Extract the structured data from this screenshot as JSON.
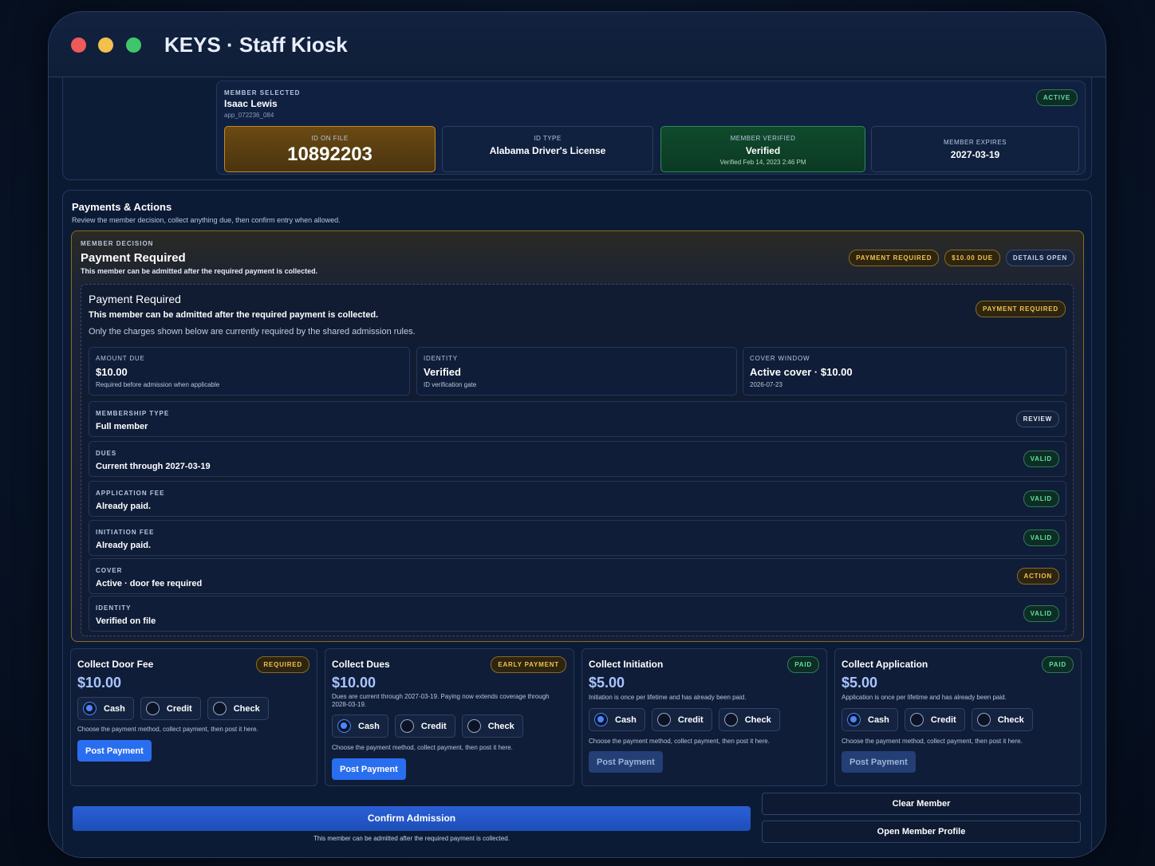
{
  "app": {
    "title": "KEYS · Staff Kiosk"
  },
  "member": {
    "section_label": "MEMBER SELECTED",
    "name": "Isaac Lewis",
    "app_id": "app_072236_084",
    "status": "ACTIVE",
    "id_on_file_label": "ID ON FILE",
    "id_on_file": "10892203",
    "id_type_label": "ID TYPE",
    "id_type": "Alabama Driver's License",
    "verified_label": "MEMBER VERIFIED",
    "verified": "Verified",
    "verified_at": "Verified Feb 14, 2023 2:46 PM",
    "expires_label": "MEMBER EXPIRES",
    "expires": "2027-03-19"
  },
  "payments": {
    "title": "Payments & Actions",
    "subtitle": "Review the member decision, collect anything due, then confirm entry when allowed."
  },
  "decision": {
    "label": "MEMBER DECISION",
    "title": "Payment Required",
    "subtitle": "This member can be admitted after the required payment is collected.",
    "pills": [
      "PAYMENT REQUIRED",
      "$10.00 DUE",
      "DETAILS OPEN"
    ],
    "detail": {
      "title": "Payment Required",
      "subtitle": "This member can be admitted after the required payment is collected.",
      "note": "Only the charges shown below are currently required by the shared admission rules.",
      "pill": "PAYMENT REQUIRED",
      "stats": [
        {
          "label": "AMOUNT DUE",
          "value": "$10.00",
          "sub": "Required before admission when applicable"
        },
        {
          "label": "IDENTITY",
          "value": "Verified",
          "sub": "ID verification gate"
        },
        {
          "label": "COVER WINDOW",
          "value": "Active cover · $10.00",
          "sub": "2026-07-23"
        }
      ],
      "rows": [
        {
          "label": "MEMBERSHIP TYPE",
          "value": "Full member",
          "status": "REVIEW"
        },
        {
          "label": "DUES",
          "value": "Current through 2027-03-19",
          "status": "VALID"
        },
        {
          "label": "APPLICATION FEE",
          "value": "Already paid.",
          "status": "VALID"
        },
        {
          "label": "INITIATION FEE",
          "value": "Already paid.",
          "status": "VALID"
        },
        {
          "label": "COVER",
          "value": "Active · door fee required",
          "status": "ACTION"
        },
        {
          "label": "IDENTITY",
          "value": "Verified on file",
          "status": "VALID"
        }
      ]
    }
  },
  "collect": [
    {
      "title": "Collect Door Fee",
      "status": "REQUIRED",
      "amount": "$10.00",
      "note": "",
      "methods": [
        "Cash",
        "Credit",
        "Check"
      ],
      "selected": "Cash",
      "hint": "Choose the payment method, collect payment, then post it here.",
      "button": "Post Payment"
    },
    {
      "title": "Collect Dues",
      "status": "EARLY PAYMENT",
      "amount": "$10.00",
      "note": "Dues are current through 2027-03-19. Paying now extends coverage through 2028-03-19.",
      "methods": [
        "Cash",
        "Credit",
        "Check"
      ],
      "selected": "Cash",
      "hint": "Choose the payment method, collect payment, then post it here.",
      "button": "Post Payment"
    },
    {
      "title": "Collect Initiation",
      "status": "PAID",
      "amount": "$5.00",
      "note": "Initiation is once per lifetime and has already been paid.",
      "methods": [
        "Cash",
        "Credit",
        "Check"
      ],
      "selected": "Cash",
      "hint": "Choose the payment method, collect payment, then post it here.",
      "button": "Post Payment"
    },
    {
      "title": "Collect Application",
      "status": "PAID",
      "amount": "$5.00",
      "note": "Application is once per lifetime and has already been paid.",
      "methods": [
        "Cash",
        "Credit",
        "Check"
      ],
      "selected": "Cash",
      "hint": "Choose the payment method, collect payment, then post it here.",
      "button": "Post Payment"
    }
  ],
  "actions": {
    "confirm": "Confirm Admission",
    "confirm_note": "This member can be admitted after the required payment is collected.",
    "clear": "Clear Member",
    "open_profile": "Open Member Profile"
  }
}
